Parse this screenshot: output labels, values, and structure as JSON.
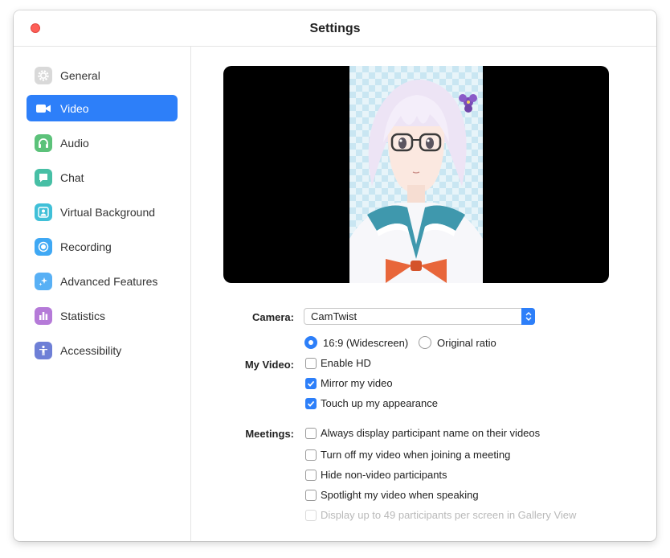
{
  "window": {
    "title": "Settings"
  },
  "sidebar": {
    "items": [
      {
        "label": "General",
        "icon": "gear-icon",
        "color": "#d9d9d9",
        "active": false
      },
      {
        "label": "Video",
        "icon": "video-camera-icon",
        "color": "#2d7ff9",
        "active": true
      },
      {
        "label": "Audio",
        "icon": "headphones-icon",
        "color": "#5cc27a",
        "active": false
      },
      {
        "label": "Chat",
        "icon": "chat-bubble-icon",
        "color": "#47bfa5",
        "active": false
      },
      {
        "label": "Virtual Background",
        "icon": "person-background-icon",
        "color": "#40c0d8",
        "active": false
      },
      {
        "label": "Recording",
        "icon": "record-icon",
        "color": "#3fa8f4",
        "active": false
      },
      {
        "label": "Advanced Features",
        "icon": "sparkle-icon",
        "color": "#58b0f5",
        "active": false
      },
      {
        "label": "Statistics",
        "icon": "bar-chart-icon",
        "color": "#b57ad8",
        "active": false
      },
      {
        "label": "Accessibility",
        "icon": "accessibility-person-icon",
        "color": "#6e7fd6",
        "active": false
      }
    ]
  },
  "video": {
    "camera_label": "Camera:",
    "camera_value": "CamTwist",
    "my_video_label": "My Video:",
    "aspect_options": [
      {
        "label": "16:9 (Widescreen)",
        "selected": true
      },
      {
        "label": "Original ratio",
        "selected": false
      }
    ],
    "my_video_options": [
      {
        "label": "Enable HD",
        "checked": false
      },
      {
        "label": "Mirror my video",
        "checked": true
      },
      {
        "label": "Touch up my appearance",
        "checked": true
      }
    ],
    "meetings_label": "Meetings:",
    "meetings_options": [
      {
        "label": "Always display participant name on their videos",
        "checked": false,
        "disabled": false
      },
      {
        "label": "Turn off my video when joining a meeting",
        "checked": false,
        "disabled": false
      },
      {
        "label": "Hide non-video participants",
        "checked": false,
        "disabled": false
      },
      {
        "label": "Spotlight my video when speaking",
        "checked": false,
        "disabled": false
      },
      {
        "label": "Display up to 49 participants per screen in Gallery View",
        "checked": false,
        "disabled": true
      }
    ]
  },
  "colors": {
    "accent": "#2d7ff9",
    "close_button": "#fe5f57"
  }
}
